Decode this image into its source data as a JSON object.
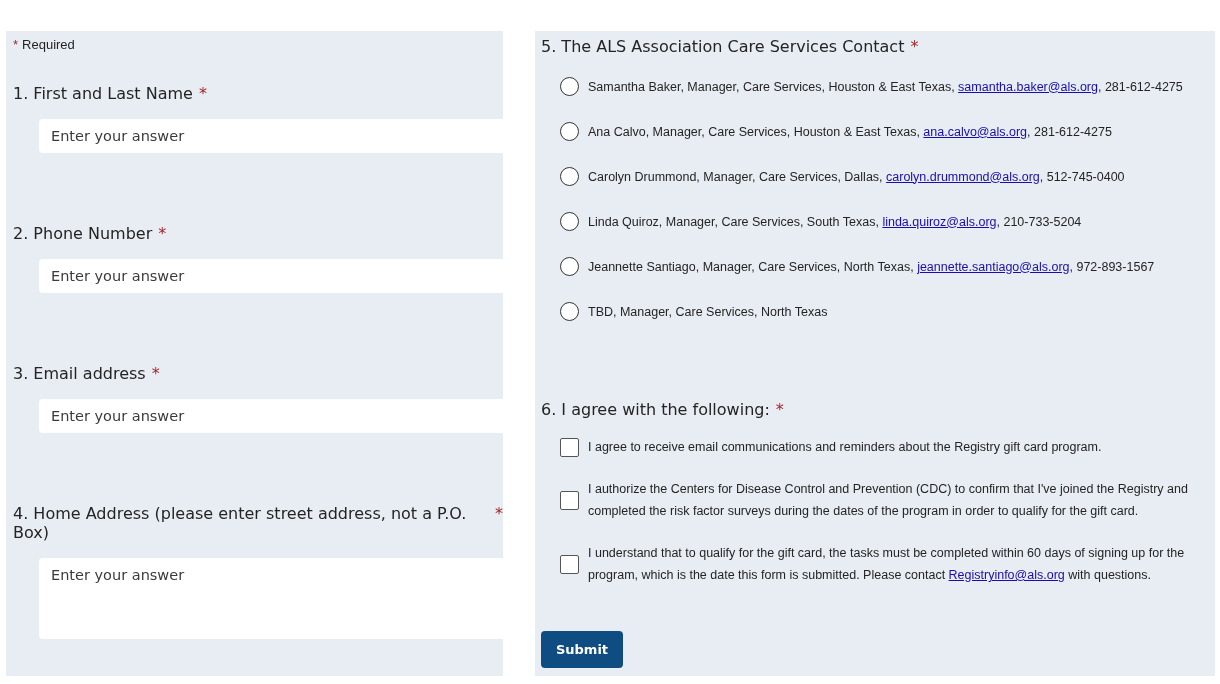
{
  "required_note": {
    "mark": "*",
    "label": "Required"
  },
  "questions": [
    {
      "number": "1.",
      "label": "First and Last Name",
      "mark": "*",
      "kind": "short",
      "placeholder": "Enter your answer"
    },
    {
      "number": "2.",
      "label": "Phone Number",
      "mark": "*",
      "kind": "short",
      "placeholder": "Enter your answer"
    },
    {
      "number": "3.",
      "label": "Email address",
      "mark": "*",
      "kind": "short",
      "placeholder": "Enter your answer"
    },
    {
      "number": "4.",
      "label": "Home Address (please enter street address, not a P.O. Box)",
      "mark": "*",
      "kind": "long",
      "placeholder": "Enter your answer"
    }
  ],
  "contact_question": {
    "number": "5.",
    "label": "The ALS Association Care Services Contact",
    "mark": "*",
    "options": [
      {
        "text": "Samantha Baker, Manager, Care Services, Houston & East Texas, ",
        "email": "samantha.baker@als.org",
        "after": ", 281-612-4275",
        "selected": false
      },
      {
        "text": "Ana Calvo, Manager, Care Services, Houston & East Texas, ",
        "email": "ana.calvo@als.org",
        "after": ", 281-612-4275",
        "selected": false
      },
      {
        "text": "Carolyn Drummond, Manager, Care Services, Dallas, ",
        "email": "carolyn.drummond@als.org",
        "after": ", 512-745-0400",
        "selected": false
      },
      {
        "text": "Linda Quiroz, Manager, Care Services, South Texas, ",
        "email": "linda.quiroz@als.org",
        "after": ", 210-733-5204",
        "selected": false
      },
      {
        "text": "Jeannette Santiago, Manager, Care Services, North Texas, ",
        "email": "jeannette.santiago@als.org",
        "after": ", 972-893-1567",
        "selected": false
      },
      {
        "text": "TBD, Manager, Care Services, North Texas",
        "selected": false
      }
    ]
  },
  "agree_question": {
    "number": "6.",
    "label": "I agree with the following:",
    "mark": "*",
    "items": [
      {
        "text": "I agree to receive email communications and reminders about the Registry gift card program.",
        "checked": false
      },
      {
        "text": "I authorize the Centers for Disease Control and Prevention (CDC) to confirm that I've joined the Registry and completed the risk factor surveys during the dates of the program in order to qualify for the gift card.",
        "checked": false
      },
      {
        "text": "I understand that to qualify for the gift card, the tasks must be completed within 60 days of signing up for the program, which is the date this form is submitted. Please contact ",
        "email": "Registryinfo@als.org",
        "after": " with questions.",
        "checked": false
      }
    ]
  },
  "submit": {
    "label": "Submit"
  }
}
